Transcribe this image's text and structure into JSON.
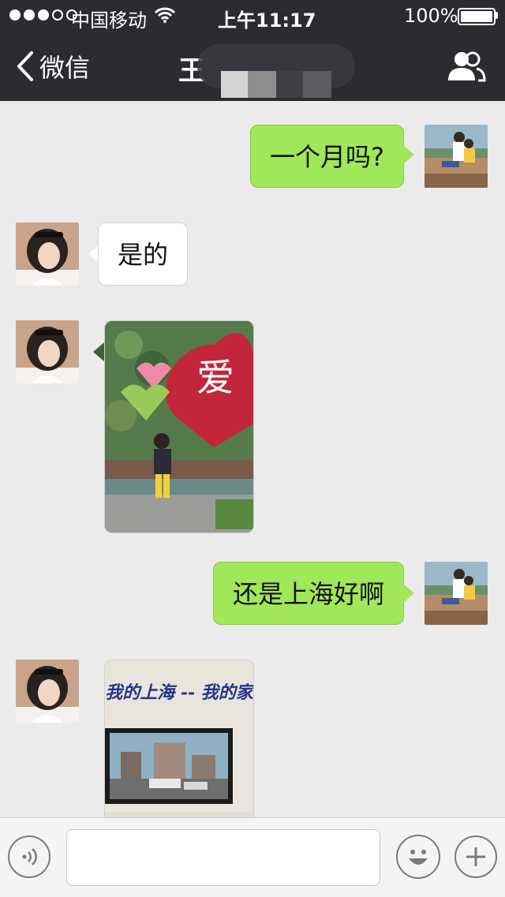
{
  "status_bar": {
    "carrier": "中国移动",
    "time": "上午11:17",
    "battery": "100%"
  },
  "nav": {
    "back_label": "微信",
    "title": "王"
  },
  "messages": [
    {
      "from": "me",
      "type": "text",
      "text": "一个月吗?"
    },
    {
      "from": "them",
      "type": "text",
      "text": "是的"
    },
    {
      "from": "them",
      "type": "image",
      "caption": "爱"
    },
    {
      "from": "me",
      "type": "text",
      "text": "还是上海好啊"
    },
    {
      "from": "them",
      "type": "image",
      "caption": "我的上海 -- 我的家"
    }
  ],
  "input": {
    "placeholder": ""
  },
  "icons": {
    "back": "chevron-left-icon",
    "contact": "people-icon",
    "voice": "voice-icon",
    "emoji": "emoji-icon",
    "plus": "plus-icon"
  },
  "colors": {
    "nav_bg": "#2b2c30",
    "my_bubble": "#a0e759",
    "their_bubble": "#ffffff",
    "chat_bg": "#ebebeb"
  }
}
